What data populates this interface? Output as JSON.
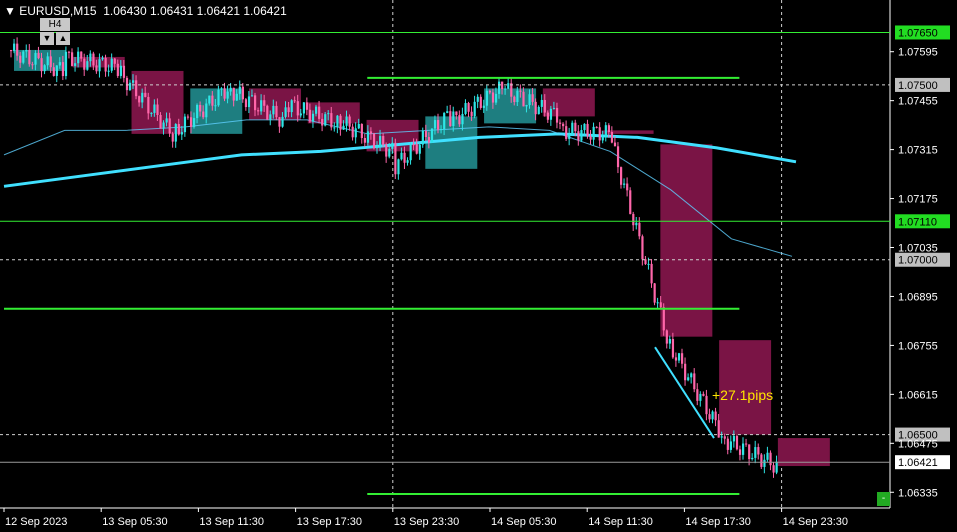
{
  "header": {
    "symbol_timeframe": "EURUSD,M15",
    "quote": "1.06430 1.06431 1.06421 1.06421",
    "tf_label": "H4",
    "tf_down_icon": "triangle-down",
    "tf_up_icon": "triangle-up"
  },
  "annotation": {
    "pips_text": "+27.1pips"
  },
  "corner_button": {
    "label": "-"
  },
  "colors": {
    "background": "#000000",
    "bull_body": "#2ee6e6",
    "bear_body": "#ff66aa",
    "h4_bull_box": "#1e7e80",
    "h4_bear_box": "#7a1445",
    "level_line": "#33ee33",
    "ma_fast": "#5fd0ff",
    "ma_slow": "#40e0ff",
    "highlight_label": "#22dd22",
    "price_label": "#c0c0c0"
  },
  "chart_data": {
    "type": "candlestick",
    "symbol": "EURUSD",
    "timeframe": "M15",
    "ylim": [
      1.0629,
      1.0772
    ],
    "price_ticks": [
      "1.07595",
      "1.07455",
      "1.07315",
      "1.07175",
      "1.07035",
      "1.06895",
      "1.06755",
      "1.06615",
      "1.06475",
      "1.06335"
    ],
    "time_ticks": [
      "12 Sep 2023",
      "13 Sep 05:30",
      "13 Sep 11:30",
      "13 Sep 17:30",
      "13 Sep 23:30",
      "14 Sep 05:30",
      "14 Sep 11:30",
      "14 Sep 17:30",
      "14 Sep 23:30"
    ],
    "horizontal_levels": [
      {
        "price": 1.0765,
        "label": "1.07650",
        "style": "solid",
        "highlight": true
      },
      {
        "price": 1.075,
        "label": "1.07500",
        "style": "dashed",
        "highlight": false
      },
      {
        "price": 1.0711,
        "label": "1.07110",
        "style": "solid",
        "highlight": true
      },
      {
        "price": 1.07,
        "label": "1.07000",
        "style": "dashed",
        "highlight": false
      },
      {
        "price": 1.065,
        "label": "1.06500",
        "style": "dashed",
        "highlight": false
      },
      {
        "price": 1.06421,
        "label": "1.06421",
        "style": "current",
        "highlight": false
      }
    ],
    "support_resistance_segments": [
      {
        "price": 1.0752,
        "from": 0.41,
        "to": 0.83
      },
      {
        "price": 1.0686,
        "from": 0.0,
        "to": 0.83
      },
      {
        "price": 1.0633,
        "from": 0.41,
        "to": 0.83
      }
    ],
    "h4_boxes": [
      {
        "open": 1.076,
        "close": 1.0754,
        "dir": "bull"
      },
      {
        "open": 1.0758,
        "close": 1.0755,
        "dir": "bear"
      },
      {
        "open": 1.0754,
        "close": 1.0736,
        "dir": "bear"
      },
      {
        "open": 1.0736,
        "close": 1.0749,
        "dir": "bull"
      },
      {
        "open": 1.0749,
        "close": 1.074,
        "dir": "bear"
      },
      {
        "open": 1.0745,
        "close": 1.0739,
        "dir": "bear"
      },
      {
        "open": 1.074,
        "close": 1.0731,
        "dir": "bear"
      },
      {
        "open": 1.0726,
        "close": 1.0741,
        "dir": "bull"
      },
      {
        "open": 1.0739,
        "close": 1.0749,
        "dir": "bull"
      },
      {
        "open": 1.0749,
        "close": 1.0741,
        "dir": "bear"
      },
      {
        "open": 1.0737,
        "close": 1.0736,
        "dir": "bear"
      },
      {
        "open": 1.0733,
        "close": 1.0678,
        "dir": "bear"
      },
      {
        "open": 1.0677,
        "close": 1.065,
        "dir": "bear"
      },
      {
        "open": 1.0649,
        "close": 1.0641,
        "dir": "bear"
      }
    ],
    "ma_slow_points": [
      1.0721,
      1.0724,
      1.0727,
      1.073,
      1.0731,
      1.0733,
      1.0735,
      1.0736,
      1.0735,
      1.0732,
      1.0728
    ],
    "ma_fast_points": [
      1.073,
      1.0737,
      1.0737,
      1.0738,
      1.074,
      1.074,
      1.0736,
      1.0737,
      1.0738,
      1.0737,
      1.0731,
      1.072,
      1.0706,
      1.0701
    ],
    "entry_line": {
      "from_price": 1.0675,
      "to_price": 1.0649
    },
    "grid": true,
    "last_price": 1.06421
  }
}
